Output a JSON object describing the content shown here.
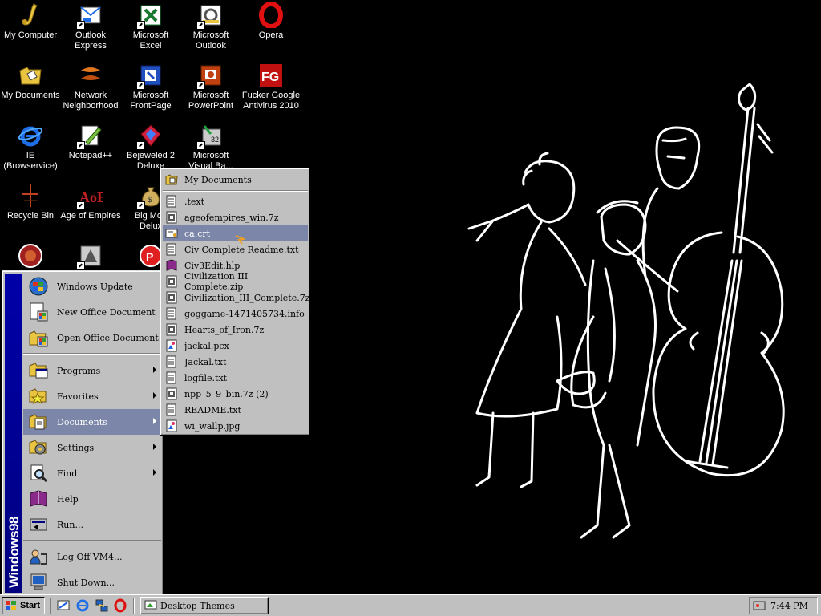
{
  "desktop": {
    "icons": [
      {
        "label": "My Computer"
      },
      {
        "label": "Outlook\nExpress"
      },
      {
        "label": "Microsoft\nExcel"
      },
      {
        "label": "Microsoft\nOutlook"
      },
      {
        "label": "Opera"
      },
      {
        "label": "My Documents"
      },
      {
        "label": "Network\nNeighborhood"
      },
      {
        "label": "Microsoft\nFrontPage"
      },
      {
        "label": "Microsoft\nPowerPoint"
      },
      {
        "label": "Fucker Google\nAntivirus 2010"
      },
      {
        "label": "IE\n(Browservice)"
      },
      {
        "label": "Notepad++"
      },
      {
        "label": "Bejeweled 2\nDeluxe"
      },
      {
        "label": "Microsoft\nVisual Ba..."
      },
      {
        "label": "Recycle Bin"
      },
      {
        "label": "Age of Empires"
      },
      {
        "label": "Big Mon\nDelux"
      }
    ]
  },
  "start_menu": {
    "banner": "Windows98",
    "items": [
      {
        "label": "Windows Update",
        "icon": "windows-update-icon"
      },
      {
        "label": "New Office Document",
        "icon": "new-office-document-icon"
      },
      {
        "label": "Open Office Document",
        "icon": "open-office-document-icon"
      },
      {
        "label": "Programs",
        "icon": "programs-icon"
      },
      {
        "label": "Favorites",
        "icon": "favorites-icon"
      },
      {
        "label": "Documents",
        "icon": "documents-icon"
      },
      {
        "label": "Settings",
        "icon": "settings-icon"
      },
      {
        "label": "Find",
        "icon": "find-icon"
      },
      {
        "label": "Help",
        "icon": "help-icon"
      },
      {
        "label": "Run...",
        "icon": "run-icon"
      },
      {
        "label": "Log Off VM4...",
        "icon": "log-off-icon"
      },
      {
        "label": "Shut Down...",
        "icon": "shut-down-icon"
      }
    ]
  },
  "documents_menu": {
    "header": "My Documents",
    "files": [
      {
        "label": ".text"
      },
      {
        "label": "ageofempires_win.7z"
      },
      {
        "label": "ca.crt"
      },
      {
        "label": "Civ Complete Readme.txt"
      },
      {
        "label": "Civ3Edit.hlp"
      },
      {
        "label": "Civilization III Complete.zip"
      },
      {
        "label": "Civilization_III_Complete.7z"
      },
      {
        "label": "goggame-1471405734.info"
      },
      {
        "label": "Hearts_of_Iron.7z"
      },
      {
        "label": "jackal.pcx"
      },
      {
        "label": "Jackal.txt"
      },
      {
        "label": "logfile.txt"
      },
      {
        "label": "npp_5_9_bin.7z (2)"
      },
      {
        "label": "README.txt"
      },
      {
        "label": "wi_wallp.jpg"
      }
    ],
    "selected": "ca.crt"
  },
  "taskbar": {
    "start_label": "Start",
    "task_label": "Desktop Themes",
    "clock": "7:44 PM"
  },
  "colors": {
    "desktop": "#000000",
    "menu_face": "#c0c0c0",
    "highlight": "#7b86a8",
    "banner": "#000080"
  }
}
